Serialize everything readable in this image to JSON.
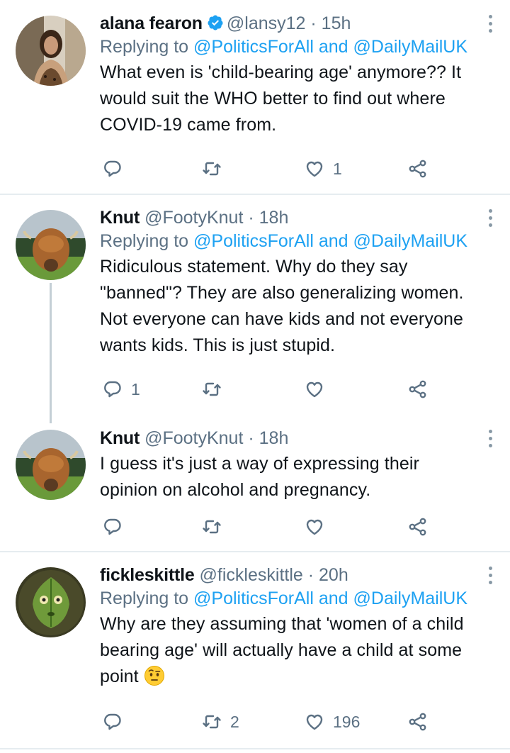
{
  "tweets": [
    {
      "name": "alana fearon",
      "verified": true,
      "handle": "@lansy12",
      "time": "· 15h",
      "replying_prefix": "Replying to",
      "replying_to_1": "@PoliticsForAll",
      "replying_and": "and",
      "replying_to_2": "@DailyMailUK",
      "lines": [
        "What even is 'child-bearing age' anymore?? It",
        "would suit the WHO better to find out where",
        "COVID-19 came from."
      ],
      "reply_count": "",
      "retweet_count": "",
      "like_count": "1"
    },
    {
      "name": "Knut",
      "handle": "@FootyKnut",
      "time": "· 18h",
      "replying_prefix": "Replying to",
      "replying_to_1": "@PoliticsForAll",
      "replying_and": "and",
      "replying_to_2": "@DailyMailUK",
      "lines": [
        "Ridiculous statement. Why do they say",
        "\"banned\"? They are also generalizing women.",
        "Not everyone can have kids and not everyone",
        "wants kids. This is just stupid."
      ],
      "reply_count": "1",
      "retweet_count": "",
      "like_count": ""
    },
    {
      "name": "Knut",
      "handle": "@FootyKnut",
      "time": "· 18h",
      "lines": [
        "I guess it's just a way of expressing their",
        "opinion on alcohol and pregnancy."
      ],
      "reply_count": "",
      "retweet_count": "",
      "like_count": ""
    },
    {
      "name": "fickleskittle",
      "handle": "@fickleskittle",
      "time": "· 20h",
      "replying_prefix": "Replying to",
      "replying_to_1": "@PoliticsForAll",
      "replying_and": "and",
      "replying_to_2": "@DailyMailUK",
      "lines": [
        "Why are they assuming that 'women of a child",
        "bearing age' will actually have a child at some",
        "point"
      ],
      "emoji": "raised-eyebrow-emoji",
      "reply_count": "",
      "retweet_count": "2",
      "like_count": "196"
    }
  ],
  "colors": {
    "text": "#0f1419",
    "secondary": "#5b7083",
    "link": "#1da1f2",
    "divider": "#e6ecf0",
    "verified": "#1da1f2"
  }
}
